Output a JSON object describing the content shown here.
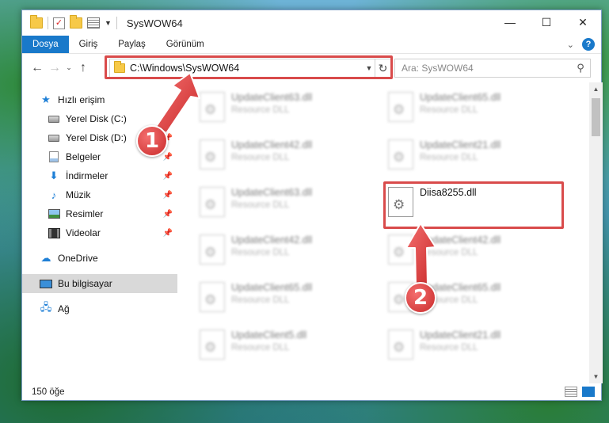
{
  "window": {
    "title": "SysWOW64",
    "controls": {
      "minimize": "—",
      "maximize": "☐",
      "close": "✕"
    }
  },
  "ribbon": {
    "tabs": [
      "Dosya",
      "Giriş",
      "Paylaş",
      "Görünüm"
    ],
    "help": "?"
  },
  "address": {
    "path": "C:\\Windows\\SysWOW64",
    "search_placeholder": "Ara: SysWOW64"
  },
  "nav": {
    "quick_access": "Hızlı erişim",
    "items": [
      {
        "label": "Yerel Disk (C:)",
        "icon": "disk-icon",
        "pinned": false
      },
      {
        "label": "Yerel Disk (D:)",
        "icon": "disk-icon",
        "pinned": true
      },
      {
        "label": "Belgeler",
        "icon": "documents-icon",
        "pinned": true
      },
      {
        "label": "İndirmeler",
        "icon": "downloads-icon",
        "pinned": true
      },
      {
        "label": "Müzik",
        "icon": "music-icon",
        "pinned": true
      },
      {
        "label": "Resimler",
        "icon": "pictures-icon",
        "pinned": true
      },
      {
        "label": "Videolar",
        "icon": "videos-icon",
        "pinned": true
      }
    ],
    "onedrive": "OneDrive",
    "this_pc": "Bu bilgisayar",
    "network": "Ağ"
  },
  "files": {
    "left_column": [
      {
        "name": "UpdateClient63.dll",
        "desc": "Resource DLL"
      },
      {
        "name": "UpdateClient42.dll",
        "desc": "Resource DLL"
      },
      {
        "name": "UpdateClient63.dll",
        "desc": "Resource DLL"
      },
      {
        "name": "UpdateClient42.dll",
        "desc": "Resource DLL"
      },
      {
        "name": "UpdateClient65.dll",
        "desc": "Resource DLL"
      },
      {
        "name": "UpdateClient5.dll",
        "desc": "Resource DLL"
      }
    ],
    "right_column": [
      {
        "name": "UpdateClient65.dll",
        "desc": "Resource DLL"
      },
      {
        "name": "UpdateClient21.dll",
        "desc": "Resource DLL"
      },
      {
        "name": "Diisa8255.dll",
        "desc": ""
      },
      {
        "name": "UpdateClient42.dll",
        "desc": "Resource DLL"
      },
      {
        "name": "UpdateClient65.dll",
        "desc": "Resource DLL"
      },
      {
        "name": "UpdateClient21.dll",
        "desc": "Resource DLL"
      }
    ],
    "highlighted": "Diisa8255.dll"
  },
  "status": {
    "item_count": "150 öğe"
  },
  "callouts": {
    "first": "1",
    "second": "2"
  },
  "colors": {
    "accent": "#1979ca",
    "highlight": "#d94b4b"
  }
}
